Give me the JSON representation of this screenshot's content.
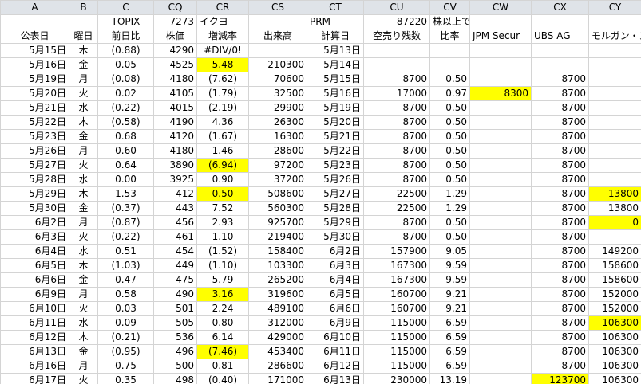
{
  "column_letters": [
    "A",
    "B",
    "C",
    "CQ",
    "CR",
    "CS",
    "CT",
    "CU",
    "CV",
    "CW",
    "CX",
    "CY"
  ],
  "top_row": [
    "",
    "",
    "TOPIX",
    "7273",
    "イクヨ",
    "",
    "PRM",
    "87220",
    "株以上で報告",
    "",
    "",
    ""
  ],
  "header_row": [
    "公表日",
    "曜日",
    "前日比",
    "株価",
    "増減率",
    "出来高",
    "計算日",
    "空売り残数",
    "比率",
    "JPM Secur",
    "UBS AG",
    "モルガン・ス"
  ],
  "rows": [
    {
      "cells": [
        "5月15日",
        "木",
        "(0.88)",
        "4290",
        "#DIV/0!",
        "",
        "5月13日",
        "",
        "",
        "",
        "",
        ""
      ],
      "red": [
        2
      ],
      "hl": []
    },
    {
      "cells": [
        "5月16日",
        "金",
        "0.05",
        "4525",
        "5.48",
        "210300",
        "5月14日",
        "",
        "",
        "",
        "",
        ""
      ],
      "red": [],
      "hl": [
        4
      ]
    },
    {
      "cells": [
        "5月19日",
        "月",
        "(0.08)",
        "4180",
        "(7.62)",
        "70600",
        "5月15日",
        "8700",
        "0.50",
        "",
        "8700",
        ""
      ],
      "red": [
        2,
        4
      ],
      "hl": []
    },
    {
      "cells": [
        "5月20日",
        "火",
        "0.02",
        "4105",
        "(1.79)",
        "32500",
        "5月16日",
        "17000",
        "0.97",
        "8300",
        "8700",
        ""
      ],
      "red": [
        4
      ],
      "hl": [
        9
      ]
    },
    {
      "cells": [
        "5月21日",
        "水",
        "(0.22)",
        "4015",
        "(2.19)",
        "29900",
        "5月19日",
        "8700",
        "0.50",
        "",
        "8700",
        ""
      ],
      "red": [
        2,
        4
      ],
      "hl": []
    },
    {
      "cells": [
        "5月22日",
        "木",
        "(0.58)",
        "4190",
        "4.36",
        "26300",
        "5月20日",
        "8700",
        "0.50",
        "",
        "8700",
        ""
      ],
      "red": [
        2
      ],
      "hl": []
    },
    {
      "cells": [
        "5月23日",
        "金",
        "0.68",
        "4120",
        "(1.67)",
        "16300",
        "5月21日",
        "8700",
        "0.50",
        "",
        "8700",
        ""
      ],
      "red": [
        4
      ],
      "hl": []
    },
    {
      "cells": [
        "5月26日",
        "月",
        "0.60",
        "4180",
        "1.46",
        "28600",
        "5月22日",
        "8700",
        "0.50",
        "",
        "8700",
        ""
      ],
      "red": [],
      "hl": []
    },
    {
      "cells": [
        "5月27日",
        "火",
        "0.64",
        "3890",
        "(6.94)",
        "97200",
        "5月23日",
        "8700",
        "0.50",
        "",
        "8700",
        ""
      ],
      "red": [
        4
      ],
      "hl": [
        4
      ]
    },
    {
      "cells": [
        "5月28日",
        "水",
        "0.00",
        "3925",
        "0.90",
        "37200",
        "5月26日",
        "8700",
        "0.50",
        "",
        "8700",
        ""
      ],
      "red": [],
      "hl": []
    },
    {
      "cells": [
        "5月29日",
        "木",
        "1.53",
        "412",
        "0.50",
        "508600",
        "5月27日",
        "22500",
        "1.29",
        "",
        "8700",
        "13800"
      ],
      "red": [],
      "hl": [
        4,
        11
      ]
    },
    {
      "cells": [
        "5月30日",
        "金",
        "(0.37)",
        "443",
        "7.52",
        "560300",
        "5月28日",
        "22500",
        "1.29",
        "",
        "8700",
        "13800"
      ],
      "red": [
        2
      ],
      "hl": []
    },
    {
      "cells": [
        "6月2日",
        "月",
        "(0.87)",
        "456",
        "2.93",
        "925700",
        "5月29日",
        "8700",
        "0.50",
        "",
        "8700",
        "0"
      ],
      "red": [
        2
      ],
      "hl": [
        11
      ]
    },
    {
      "cells": [
        "6月3日",
        "火",
        "(0.22)",
        "461",
        "1.10",
        "219400",
        "5月30日",
        "8700",
        "0.50",
        "",
        "8700",
        ""
      ],
      "red": [
        2
      ],
      "hl": []
    },
    {
      "cells": [
        "6月4日",
        "水",
        "0.51",
        "454",
        "(1.52)",
        "158400",
        "6月2日",
        "157900",
        "9.05",
        "",
        "8700",
        "149200"
      ],
      "red": [
        4
      ],
      "hl": []
    },
    {
      "cells": [
        "6月5日",
        "木",
        "(1.03)",
        "449",
        "(1.10)",
        "103300",
        "6月3日",
        "167300",
        "9.59",
        "",
        "8700",
        "158600"
      ],
      "red": [
        2,
        4
      ],
      "hl": []
    },
    {
      "cells": [
        "6月6日",
        "金",
        "0.47",
        "475",
        "5.79",
        "265200",
        "6月4日",
        "167300",
        "9.59",
        "",
        "8700",
        "158600"
      ],
      "red": [],
      "hl": []
    },
    {
      "cells": [
        "6月9日",
        "月",
        "0.58",
        "490",
        "3.16",
        "319600",
        "6月5日",
        "160700",
        "9.21",
        "",
        "8700",
        "152000"
      ],
      "red": [],
      "hl": [
        4
      ]
    },
    {
      "cells": [
        "6月10日",
        "火",
        "0.03",
        "501",
        "2.24",
        "489100",
        "6月6日",
        "160700",
        "9.21",
        "",
        "8700",
        "152000"
      ],
      "red": [],
      "hl": []
    },
    {
      "cells": [
        "6月11日",
        "水",
        "0.09",
        "505",
        "0.80",
        "312000",
        "6月9日",
        "115000",
        "6.59",
        "",
        "8700",
        "106300"
      ],
      "red": [],
      "hl": [
        11
      ]
    },
    {
      "cells": [
        "6月12日",
        "木",
        "(0.21)",
        "536",
        "6.14",
        "429000",
        "6月10日",
        "115000",
        "6.59",
        "",
        "8700",
        "106300"
      ],
      "red": [
        2
      ],
      "hl": []
    },
    {
      "cells": [
        "6月13日",
        "金",
        "(0.95)",
        "496",
        "(7.46)",
        "453400",
        "6月11日",
        "115000",
        "6.59",
        "",
        "8700",
        "106300"
      ],
      "red": [
        2,
        4
      ],
      "hl": [
        4
      ]
    },
    {
      "cells": [
        "6月16日",
        "月",
        "0.75",
        "500",
        "0.81",
        "286600",
        "6月12日",
        "115000",
        "6.59",
        "",
        "8700",
        "106300"
      ],
      "red": [],
      "hl": []
    },
    {
      "cells": [
        "6月17日",
        "火",
        "0.35",
        "498",
        "(0.40)",
        "171000",
        "6月13日",
        "230000",
        "13.19",
        "",
        "123700",
        "106300"
      ],
      "red": [
        4
      ],
      "hl": [
        10
      ]
    }
  ],
  "colors": {
    "highlight": "#ffff00",
    "negative": "#ff0000",
    "column_header_bg": "#dfe3e8",
    "gridline": "#d4d4d4"
  }
}
